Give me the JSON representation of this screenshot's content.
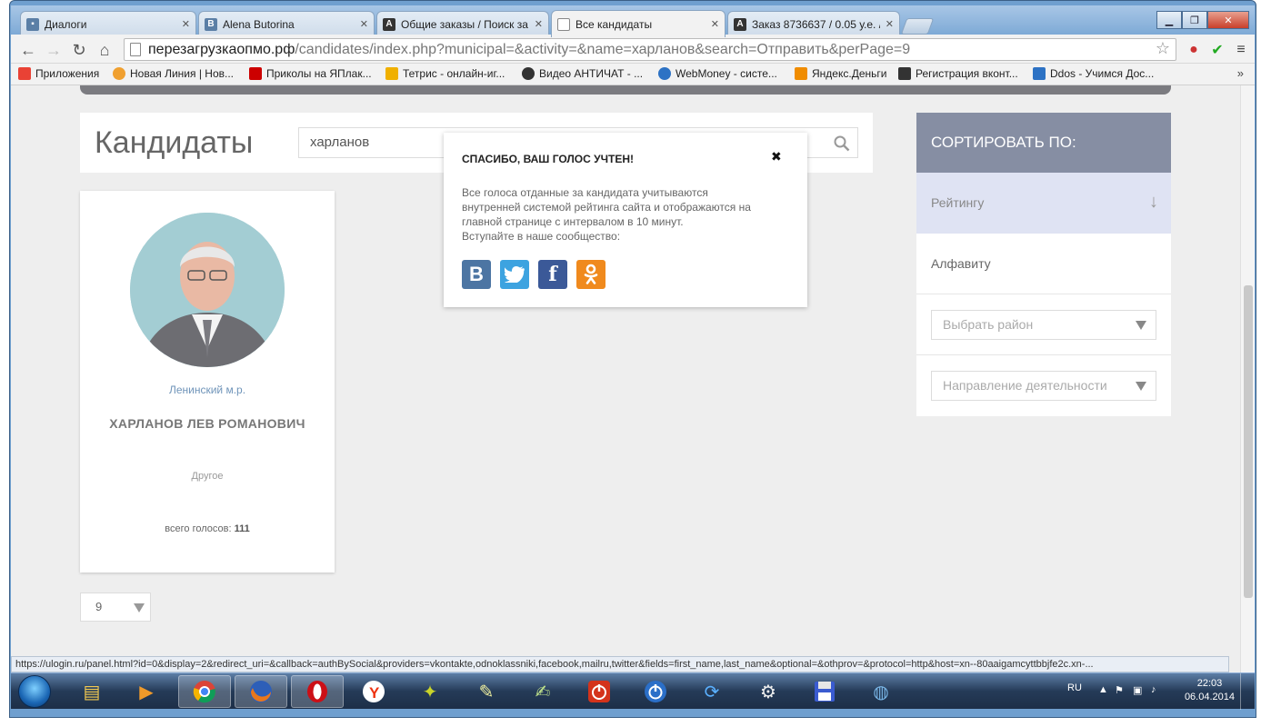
{
  "browser": {
    "tabs": [
      {
        "title": "Диалоги",
        "icon": "vk-icon",
        "color": "#5b7fa6"
      },
      {
        "title": "Alena Butorina",
        "icon": "vk-icon",
        "color": "#5b7fa6"
      },
      {
        "title": "Общие заказы / Поиск за",
        "icon": "advego-icon",
        "color": "#333333"
      },
      {
        "title": "Все кандидаты",
        "icon": "page-icon",
        "color": "#ffffff"
      },
      {
        "title": "Заказ 8736637 / 0.05 у.е. /",
        "icon": "advego-icon",
        "color": "#333333"
      }
    ],
    "url_host": "перезагрузкаопмо.рф",
    "url_path": "/candidates/index.php?municipal=&activity=&name=харланов&search=Отправить&perPage=9",
    "bookmarks": [
      {
        "label": "Приложения",
        "color": "#e94235"
      },
      {
        "label": "Новая Линия | Нов...",
        "color": "#f0a030"
      },
      {
        "label": "Приколы на ЯПлак...",
        "color": "#cc0000"
      },
      {
        "label": "Тетрис - онлайн-иг...",
        "color": "#f0b000"
      },
      {
        "label": "Видео АНТИЧАТ - ...",
        "color": "#333333"
      },
      {
        "label": "WebMoney - систе...",
        "color": "#2d72c4"
      },
      {
        "label": "Яндекс.Деньги",
        "color": "#f08c00"
      },
      {
        "label": "Регистрация вконт...",
        "color": "#333333"
      },
      {
        "label": "Ddos - Учимся Дос...",
        "color": "#2d72c4"
      }
    ],
    "bookmarks_more": "»",
    "status_url": "https://ulogin.ru/panel.html?id=0&display=2&redirect_uri=&callback=authBySocial&providers=vkontakte,odnoklassniki,facebook,mailru,twitter&fields=first_name,last_name&optional=&othprov=&protocol=http&host=xn--80aaigamcyttbbjfe2c.xn-..."
  },
  "page": {
    "title": "Кандидаты",
    "search_value": "харланов",
    "candidate": {
      "district": "Ленинский м.р.",
      "name": "ХАРЛАНОВ ЛЕВ РОМАНОВИЧ",
      "activity": "Другое",
      "votes_label": "всего голосов:",
      "votes": "111"
    },
    "per_page": "9",
    "sort": {
      "heading": "СОРТИРОВАТЬ ПО:",
      "by_rating": "Рейтингу",
      "by_alpha": "Алфавиту",
      "district_placeholder": "Выбрать район",
      "activity_placeholder": "Направление деятельности"
    }
  },
  "popup": {
    "title": "СПАСИБО, ВАШ ГОЛОС УЧТЕН!",
    "close": "✖",
    "text_lines": [
      "Все голоса отданные за кандидата учитываются",
      "внутренней системой рейтинга сайта и отображаются на",
      "главной странице с интервалом в 10 минут.",
      "Вступайте в наше сообщество:"
    ],
    "social": [
      {
        "label": "В",
        "name": "vk",
        "color": "#4c75a3"
      },
      {
        "label": "t",
        "name": "twitter",
        "color": "#3da3e0"
      },
      {
        "label": "f",
        "name": "facebook",
        "color": "#3b5998"
      },
      {
        "label": "ok",
        "name": "odnoklassniki",
        "color": "#f08a1d"
      }
    ]
  },
  "taskbar": {
    "lang": "RU",
    "time": "22:03",
    "date": "06.04.2014"
  },
  "colors": {
    "accent": "#868ea3",
    "rating_bg": "#dfe3f3",
    "link_blue": "#6f94b9"
  }
}
